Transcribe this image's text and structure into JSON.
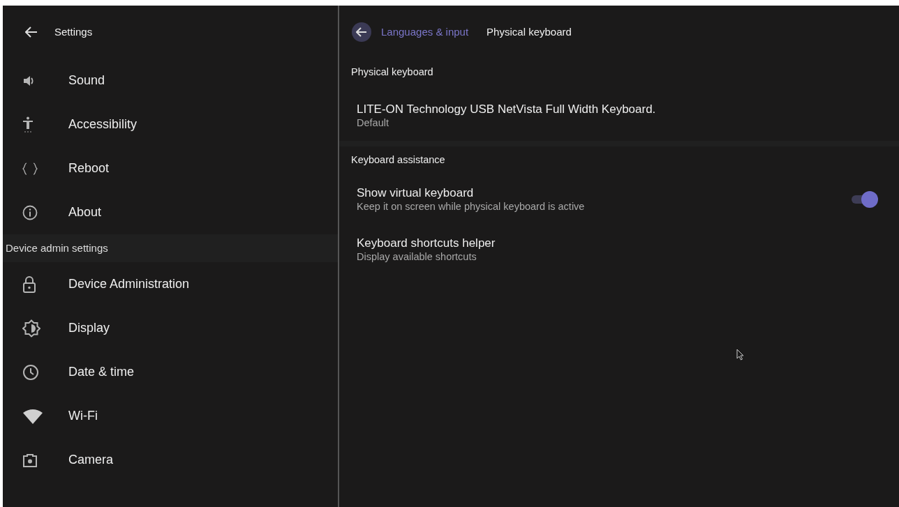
{
  "sidebar": {
    "title": "Settings",
    "items": [
      {
        "kind": "item",
        "label": "Sound"
      },
      {
        "kind": "item",
        "label": "Accessibility"
      },
      {
        "kind": "item",
        "label": "Reboot"
      },
      {
        "kind": "item",
        "label": "About"
      },
      {
        "kind": "section",
        "label": "Device admin settings"
      },
      {
        "kind": "item",
        "label": "Device Administration"
      },
      {
        "kind": "item",
        "label": "Display"
      },
      {
        "kind": "item",
        "label": "Date & time"
      },
      {
        "kind": "item",
        "label": "Wi-Fi"
      },
      {
        "kind": "item",
        "label": "Camera"
      }
    ]
  },
  "breadcrumb": {
    "parent": "Languages & input",
    "current": "Physical keyboard"
  },
  "sections": [
    {
      "title": "Physical keyboard",
      "items": [
        {
          "kind": "plain",
          "title": "LITE-ON Technology USB NetVista Full Width Keyboard.",
          "subtitle": "Default"
        }
      ]
    },
    {
      "title": "Keyboard assistance",
      "items": [
        {
          "kind": "toggle",
          "title": "Show virtual keyboard",
          "subtitle": "Keep it on screen while physical keyboard is active",
          "on": true
        },
        {
          "kind": "plain",
          "title": "Keyboard shortcuts helper",
          "subtitle": "Display available shortcuts"
        }
      ]
    }
  ]
}
